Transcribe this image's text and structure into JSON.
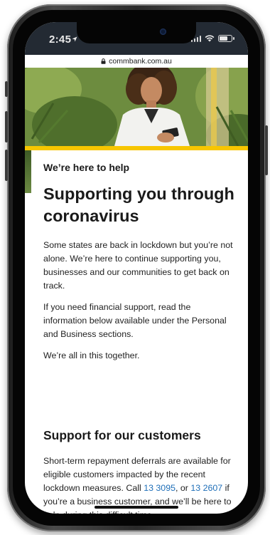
{
  "status_bar": {
    "time": "2:45"
  },
  "browser": {
    "url": "commbank.com.au"
  },
  "content": {
    "eyebrow": "We’re here to help",
    "headline": "Supporting you through coronavirus",
    "paragraphs": [
      "Some states are back in lockdown but you’re not alone. We’re here to continue supporting you, businesses and our communities to get back on track.",
      "If you need financial support, read the information below available under the Personal and Business sections.",
      "We’re all in this together."
    ]
  },
  "support_section": {
    "heading": "Support for our customers",
    "text_before": "Short-term repayment deferrals are available for eligible customers impacted by the recent lockdown measures. Call ",
    "phone_1": "13 3095",
    "text_middle": ", or ",
    "phone_2": "13 2607",
    "text_after": " if you’re a business customer, and we’ll be here to help during this difficult time."
  },
  "colors": {
    "accent_yellow": "#f7c600",
    "link_blue": "#1f6fb8",
    "status_bar_bg": "#232a33"
  }
}
